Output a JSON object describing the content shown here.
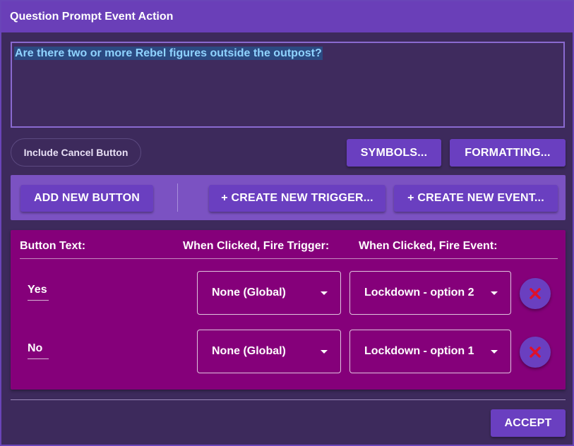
{
  "window": {
    "title": "Question Prompt Event Action"
  },
  "prompt": {
    "text": "Are there two or more Rebel figures outside the outpost?"
  },
  "options": {
    "include_cancel_label": "Include Cancel Button"
  },
  "toolbar": {
    "symbols_label": "SYMBOLS...",
    "formatting_label": "FORMATTING...",
    "add_button_label": "ADD NEW BUTTON",
    "create_trigger_label": "+ CREATE NEW TRIGGER...",
    "create_event_label": "+ CREATE NEW EVENT..."
  },
  "table": {
    "headers": {
      "button_text": "Button Text:",
      "fire_trigger": "When Clicked, Fire Trigger:",
      "fire_event": "When Clicked, Fire Event:"
    },
    "rows": [
      {
        "text": "Yes",
        "trigger": "None (Global)",
        "event": "Lockdown - option 2"
      },
      {
        "text": "No",
        "trigger": "None (Global)",
        "event": "Lockdown - option 1"
      }
    ]
  },
  "footer": {
    "accept_label": "ACCEPT"
  },
  "colors": {
    "background": "#3d2a5c",
    "titlebar": "#6a3fb8",
    "button": "#6a3fc0",
    "table_panel": "#85007a",
    "delete_icon": "#e0102a"
  },
  "icons": {
    "delete": "close-icon",
    "dropdown": "chevron-down-icon"
  }
}
